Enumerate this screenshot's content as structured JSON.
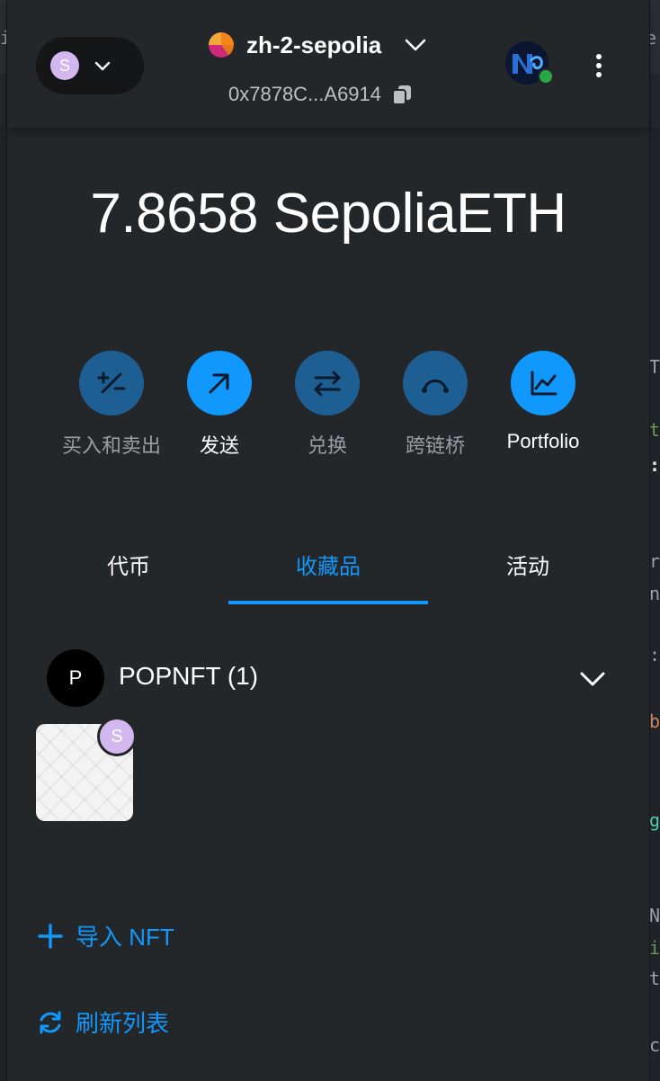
{
  "header": {
    "account_initial": "S",
    "network_name": "zh-2-sepolia",
    "address": "0x7878C...A6914"
  },
  "balance": {
    "amount": "7.8658 SepoliaETH"
  },
  "actions": [
    {
      "label": "买入和卖出",
      "icon": "buy-sell-icon",
      "enabled": false
    },
    {
      "label": "发送",
      "icon": "send-arrow-icon",
      "enabled": true
    },
    {
      "label": "兑换",
      "icon": "swap-arrows-icon",
      "enabled": false
    },
    {
      "label": "跨链桥",
      "icon": "bridge-icon",
      "enabled": false
    },
    {
      "label": "Portfolio",
      "icon": "chart-icon",
      "enabled": true
    }
  ],
  "tabs": [
    {
      "label": "代币"
    },
    {
      "label": "收藏品",
      "active": true
    },
    {
      "label": "活动"
    }
  ],
  "collection": {
    "avatar_letter": "P",
    "name": "POPNFT (1)",
    "nft_badge_initial": "S"
  },
  "links": {
    "import_nft": "导入 NFT",
    "refresh_list": "刷新列表"
  },
  "colors": {
    "accent": "#1098fc",
    "accent_dim": "#1e5f93",
    "background": "#24272a",
    "status_online": "#28a745"
  }
}
